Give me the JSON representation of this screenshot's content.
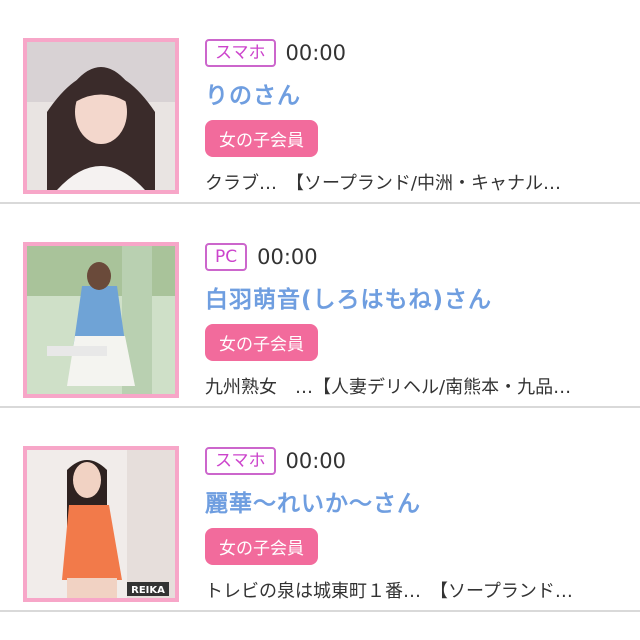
{
  "items": [
    {
      "device": "スマホ",
      "time": "00:00",
      "name": "りのさん",
      "badge": "女の子会員",
      "shop": "クラブ…　【ソープランド/中洲・キャナル…"
    },
    {
      "device": "PC",
      "time": "00:00",
      "name": "白羽萌音(しろはもね)さん",
      "badge": "女の子会員",
      "shop": "九州熟女　…【人妻デリヘル/南熊本・九品…"
    },
    {
      "device": "スマホ",
      "time": "00:00",
      "name": "麗華〜れいか〜さん",
      "badge": "女の子会員",
      "shop": "トレビの泉は城東町１番…　【ソープランド…",
      "photo_caption": "REIKA"
    }
  ],
  "colors": {
    "device_border": "#cc66cc",
    "name": "#6f9ee0",
    "badge_bg": "#f26b9c",
    "thumb_border": "#f7a6c8",
    "divider": "#d9d9d9"
  }
}
